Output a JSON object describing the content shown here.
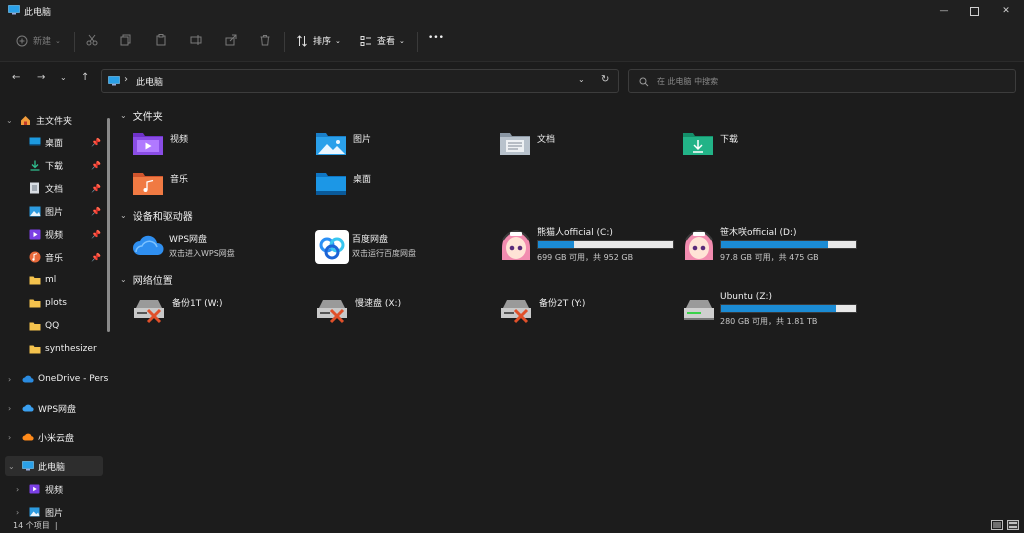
{
  "window": {
    "title": "此电脑",
    "controls": [
      "minimize-icon",
      "maximize-icon",
      "close-icon"
    ]
  },
  "toolbar": {
    "new_label": "新建",
    "sort_label": "排序",
    "view_label": "查看",
    "more_label": "•••"
  },
  "address": {
    "separator": "›",
    "location": "此电脑",
    "search_placeholder": "在 此电脑 中搜索"
  },
  "sidebar": {
    "home": "主文件夹",
    "pinned": [
      {
        "label": "桌面",
        "icon": "desktop-icon"
      },
      {
        "label": "下载",
        "icon": "download-icon"
      },
      {
        "label": "文档",
        "icon": "document-icon"
      },
      {
        "label": "图片",
        "icon": "picture-icon"
      },
      {
        "label": "视频",
        "icon": "video-icon"
      },
      {
        "label": "音乐",
        "icon": "music-icon"
      }
    ],
    "folders": [
      "ml",
      "plots",
      "QQ",
      "synthesizer"
    ],
    "onedrive": "OneDrive - Pers",
    "wps": "WPS网盘",
    "xiaomi": "小米云盘",
    "this_pc": "此电脑",
    "children": [
      "视频",
      "图片"
    ]
  },
  "main": {
    "folders_header": "文件夹",
    "folders": [
      {
        "name": "视频",
        "icon": "video-folder-icon"
      },
      {
        "name": "图片",
        "icon": "picture-folder-icon"
      },
      {
        "name": "文档",
        "icon": "document-folder-icon"
      },
      {
        "name": "下载",
        "icon": "download-folder-icon"
      },
      {
        "name": "音乐",
        "icon": "music-folder-icon"
      },
      {
        "name": "桌面",
        "icon": "desktop-folder-icon"
      }
    ],
    "devices_header": "设备和驱动器",
    "apps": [
      {
        "name": "WPS网盘",
        "sub": "双击进入WPS网盘",
        "icon": "wps-cloud-icon"
      },
      {
        "name": "百度网盘",
        "sub": "双击运行百度网盘",
        "icon": "baidu-netdisk-icon"
      }
    ],
    "drives": [
      {
        "name": "熊猫人official (C:)",
        "free": "699 GB 可用，共 952 GB",
        "used_fraction": 0.27
      },
      {
        "name": "笹木咲official (D:)",
        "free": "97.8 GB 可用，共 475 GB",
        "used_fraction": 0.79
      }
    ],
    "network_header": "网络位置",
    "network": [
      {
        "name": "备份1T (W:)",
        "icon": "disconnected-drive-icon"
      },
      {
        "name": "慢速盘 (X:)",
        "icon": "disconnected-drive-icon"
      },
      {
        "name": "备份2T (Y:)",
        "icon": "disconnected-drive-icon"
      }
    ],
    "ubuntu": {
      "name": "Ubuntu (Z:)",
      "free": "280 GB 可用，共 1.81 TB",
      "used_fraction": 0.85
    }
  },
  "status": {
    "count": "14 个项目"
  },
  "colors": {
    "accent": "#1b8bd4",
    "background": "#1c1c1c",
    "chrome": "#202020"
  }
}
